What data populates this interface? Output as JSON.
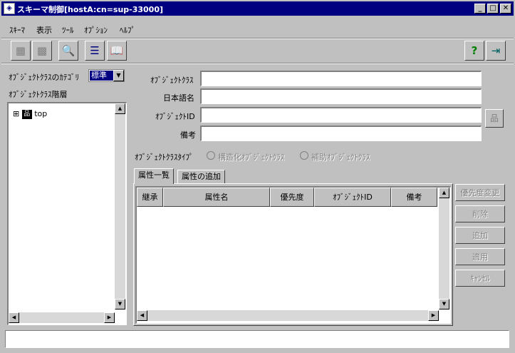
{
  "window": {
    "title": "スキーマ制御[hostA:cn=sup-33000]",
    "minimize": "_",
    "maximize": "□",
    "close": "✕"
  },
  "menu": [
    "ｽｷｰﾏ",
    "表示",
    "ﾂｰﾙ",
    "ｵﾌﾟｼｮﾝ",
    "ﾍﾙﾌﾟ"
  ],
  "left_panel": {
    "category_label": "ｵﾌﾞｼﾞｪｸﾄｸﾗｽのｶﾃｺﾞﾘ",
    "category_value": "標準",
    "hierarchy_label": "ｵﾌﾞｼﾞｪｸﾄｸﾗｽ階層",
    "tree": [
      {
        "label": "top",
        "expander": "⊞"
      }
    ]
  },
  "form": {
    "object_class_label": "ｵﾌﾞｼﾞｪｸﾄｸﾗｽ",
    "object_class_value": "",
    "japanese_name_label": "日本語名",
    "japanese_name_value": "",
    "object_id_label": "ｵﾌﾞｼﾞｪｸﾄID",
    "object_id_value": "",
    "note_label": "備考",
    "note_value": "",
    "type_label": "ｵﾌﾞｼﾞｪｸﾄｸﾗｽﾀｲﾌﾟ",
    "type_options": [
      "構造化ｵﾌﾞｼﾞｪｸﾄｸﾗｽ",
      "補助ｵﾌﾞｼﾞｪｸﾄｸﾗｽ"
    ]
  },
  "tabs": [
    "属性一覧",
    "属性の追加"
  ],
  "table": {
    "columns": [
      "継承",
      "属性名",
      "優先度",
      "ｵﾌﾞｼﾞｪｸﾄID",
      "備考"
    ],
    "rows": []
  },
  "actions": [
    "優先度変更",
    "削除",
    "追加",
    "適用",
    "ｷｬﾝｾﾙ"
  ],
  "status_bar": ""
}
